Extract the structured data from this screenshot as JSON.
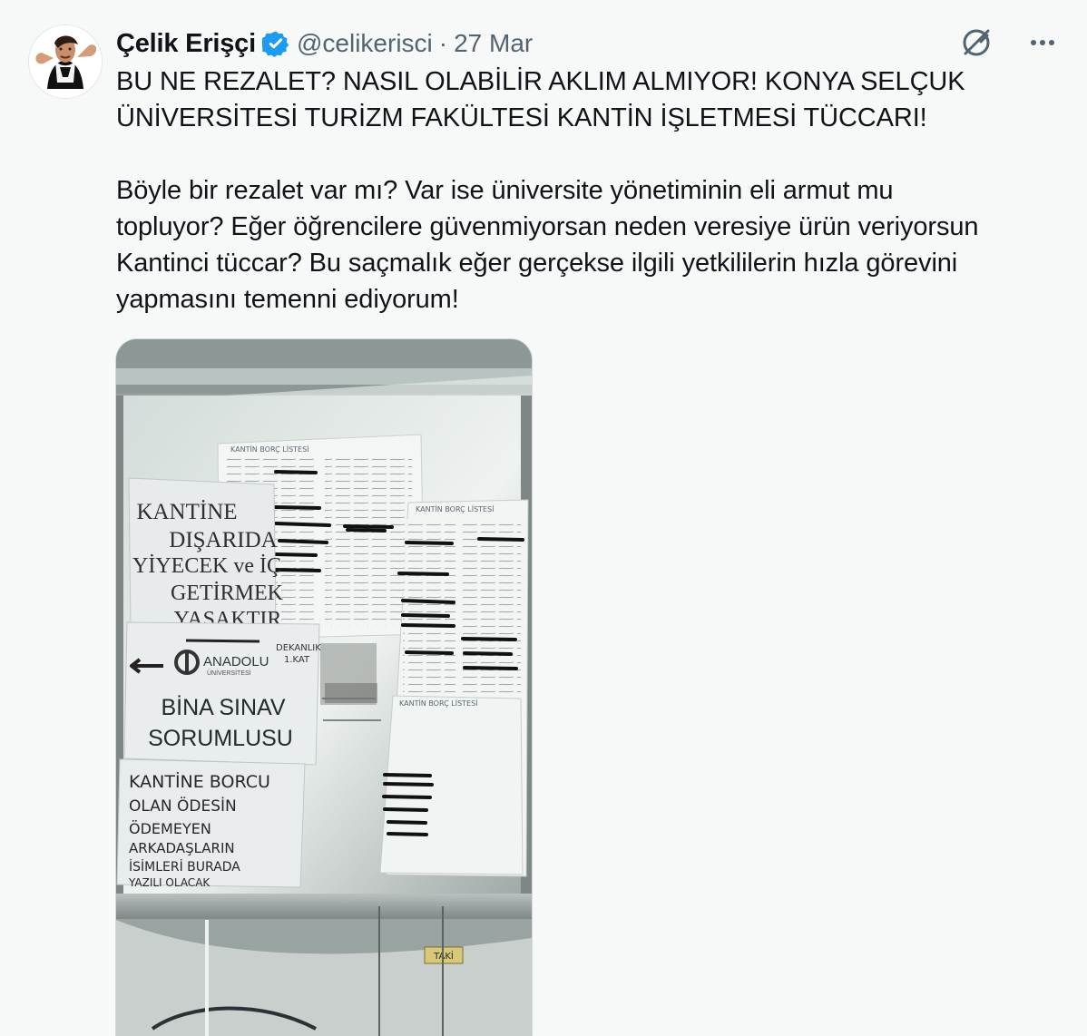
{
  "author": {
    "display_name": "Çelik Erişçi",
    "handle": "@celikerisci",
    "separator": "·",
    "date": "27 Mar",
    "verified_color": "#1d9bf0",
    "avatar_icon": "user-avatar"
  },
  "tweet": {
    "text_paragraph_1": "BU NE REZALET? NASIL OLABİLİR AKLIM ALMIYOR! KONYA SELÇUK\nÜNİVERSİTESİ TURİZM FAKÜLTESİ KANTİN İŞLETMESİ TÜCCARI!",
    "text_paragraph_2": "Böyle bir rezalet var mı? Var ise üniversite yönetiminin eli armut mu\ntopluyor? Eğer öğrencilere güvenmiyorsan neden veresiye ürün veriyorsun\nKantinci tüccar? Bu saçmalık eğer gerçekse ilgili yetkililerin hızla görevini\nyapmasını temenni ediyorum!"
  },
  "photo": {
    "sign_1": {
      "line_1": "KANTİNE",
      "line_2": "DIŞARIDA",
      "line_3": "YİYECEK ve İÇ",
      "line_4": "GETİRMEK",
      "line_5": "YASAKTIR"
    },
    "sign_2": {
      "department": "DEKANLIK",
      "floor": "1.KAT",
      "university_logo_text": "ANADOLU",
      "university_subtext": "ÜNİVERSİTESİ",
      "line_1": "BİNA SINAV",
      "line_2": "SORUMLUSU"
    },
    "sign_3": {
      "line_1": "KANTİNE BORCU",
      "line_2": "OLAN ÖDESİN",
      "line_3": "ÖDEMEYEN",
      "line_4": "ARKADAŞLARIN",
      "line_5": "İSİMLERİ BURADA",
      "line_6": "YAZILI OLACAK"
    },
    "list_header_1": "KANTİN BORÇ LİSTESİ",
    "list_header_2": "KANTİN BORÇ LİSTESİ",
    "list_header_3": "KANTİN BORÇ LİSTESİ",
    "door_label": "TAKİ"
  },
  "icons": {
    "grok": "grok-icon",
    "more": "more-icon",
    "verified": "verified-badge-icon"
  }
}
